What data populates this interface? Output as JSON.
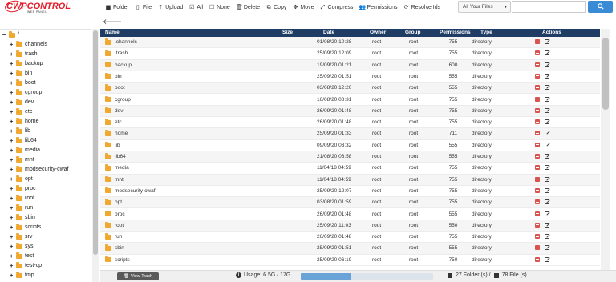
{
  "logo": {
    "text": "CWPCONTROL",
    "sub": "WEB PANEL"
  },
  "toolbar": [
    {
      "icon": "folder-icon",
      "glyph": "▆",
      "label": "Folder"
    },
    {
      "icon": "file-icon",
      "glyph": "▯",
      "label": "File"
    },
    {
      "icon": "upload-icon",
      "glyph": "⤒",
      "label": "Upload"
    },
    {
      "icon": "check-all-icon",
      "glyph": "☑",
      "label": "All"
    },
    {
      "icon": "check-none-icon",
      "glyph": "☐",
      "label": "None"
    },
    {
      "icon": "trash-icon",
      "glyph": "🗑",
      "label": "Delete"
    },
    {
      "icon": "copy-icon",
      "glyph": "⧉",
      "label": "Copy"
    },
    {
      "icon": "move-icon",
      "glyph": "✥",
      "label": "Move"
    },
    {
      "icon": "compress-icon",
      "glyph": "⤢",
      "label": "Compress"
    },
    {
      "icon": "permissions-icon",
      "glyph": "👥",
      "label": "Permissions"
    },
    {
      "icon": "resolve-ids-icon",
      "glyph": "⟳",
      "label": "Resolve Ids"
    }
  ],
  "search": {
    "filter_value": "All Your Files",
    "placeholder": ""
  },
  "tree": {
    "root_label": "/",
    "items": [
      "channels",
      "trash",
      "backup",
      "bin",
      "boot",
      "cgroup",
      "dev",
      "etc",
      "home",
      "lib",
      "lib64",
      "media",
      "mnt",
      "modsecurity-cwaf",
      "opt",
      "proc",
      "root",
      "run",
      "sbin",
      "scripts",
      "srv",
      "sys",
      "test",
      "test-cp",
      "tmp"
    ]
  },
  "table": {
    "headers": {
      "name": "Name",
      "size": "Size",
      "date": "Date",
      "owner": "Owner",
      "group": "Group",
      "permissions": "Permissions",
      "type": "Type",
      "actions": "Actions"
    },
    "rows": [
      {
        "name": ".channels",
        "date": "01/08/20 10:28",
        "owner": "root",
        "group": "root",
        "perm": "755",
        "type": "directory"
      },
      {
        "name": ".trash",
        "date": "25/09/20 12:09",
        "owner": "root",
        "group": "root",
        "perm": "755",
        "type": "directory"
      },
      {
        "name": "backup",
        "date": "19/09/20 01:21",
        "owner": "root",
        "group": "root",
        "perm": "600",
        "type": "directory"
      },
      {
        "name": "bin",
        "date": "25/09/20 01:51",
        "owner": "root",
        "group": "root",
        "perm": "555",
        "type": "directory"
      },
      {
        "name": "boot",
        "date": "03/08/20 12:20",
        "owner": "root",
        "group": "root",
        "perm": "555",
        "type": "directory"
      },
      {
        "name": "cgroup",
        "date": "16/08/20 08:31",
        "owner": "root",
        "group": "root",
        "perm": "755",
        "type": "directory"
      },
      {
        "name": "dev",
        "date": "26/09/20 01:48",
        "owner": "root",
        "group": "root",
        "perm": "755",
        "type": "directory"
      },
      {
        "name": "etc",
        "date": "26/09/20 01:48",
        "owner": "root",
        "group": "root",
        "perm": "755",
        "type": "directory"
      },
      {
        "name": "home",
        "date": "25/09/20 01:33",
        "owner": "root",
        "group": "root",
        "perm": "711",
        "type": "directory"
      },
      {
        "name": "lib",
        "date": "09/09/20 03:32",
        "owner": "root",
        "group": "root",
        "perm": "555",
        "type": "directory"
      },
      {
        "name": "lib64",
        "date": "21/08/20 06:58",
        "owner": "root",
        "group": "root",
        "perm": "555",
        "type": "directory"
      },
      {
        "name": "media",
        "date": "11/04/18 04:59",
        "owner": "root",
        "group": "root",
        "perm": "755",
        "type": "directory"
      },
      {
        "name": "mnt",
        "date": "11/04/18 04:59",
        "owner": "root",
        "group": "root",
        "perm": "755",
        "type": "directory"
      },
      {
        "name": "modsecurity-cwaf",
        "date": "25/09/20 12:07",
        "owner": "root",
        "group": "root",
        "perm": "755",
        "type": "directory"
      },
      {
        "name": "opt",
        "date": "03/08/20 01:59",
        "owner": "root",
        "group": "root",
        "perm": "755",
        "type": "directory"
      },
      {
        "name": "proc",
        "date": "26/09/20 01:48",
        "owner": "root",
        "group": "root",
        "perm": "555",
        "type": "directory"
      },
      {
        "name": "root",
        "date": "25/09/20 11:03",
        "owner": "root",
        "group": "root",
        "perm": "550",
        "type": "directory"
      },
      {
        "name": "run",
        "date": "26/09/20 01:48",
        "owner": "root",
        "group": "root",
        "perm": "755",
        "type": "directory"
      },
      {
        "name": "sbin",
        "date": "25/09/20 01:51",
        "owner": "root",
        "group": "root",
        "perm": "555",
        "type": "directory"
      },
      {
        "name": "scripts",
        "date": "25/09/20 06:19",
        "owner": "root",
        "group": "root",
        "perm": "750",
        "type": "directory"
      }
    ]
  },
  "footer": {
    "trash_label": "View Trash",
    "usage_text": "Usage: 6.5G / 17G",
    "usage_fraction": 0.38,
    "folders_text": "27 Folder (s) /",
    "files_text": "78 File (s)"
  },
  "colors": {
    "header_bg": "#1e3c64",
    "accent": "#3a8bd6",
    "folder": "#f0a830",
    "delete": "#d9534f",
    "logo": "#e11d2a"
  }
}
